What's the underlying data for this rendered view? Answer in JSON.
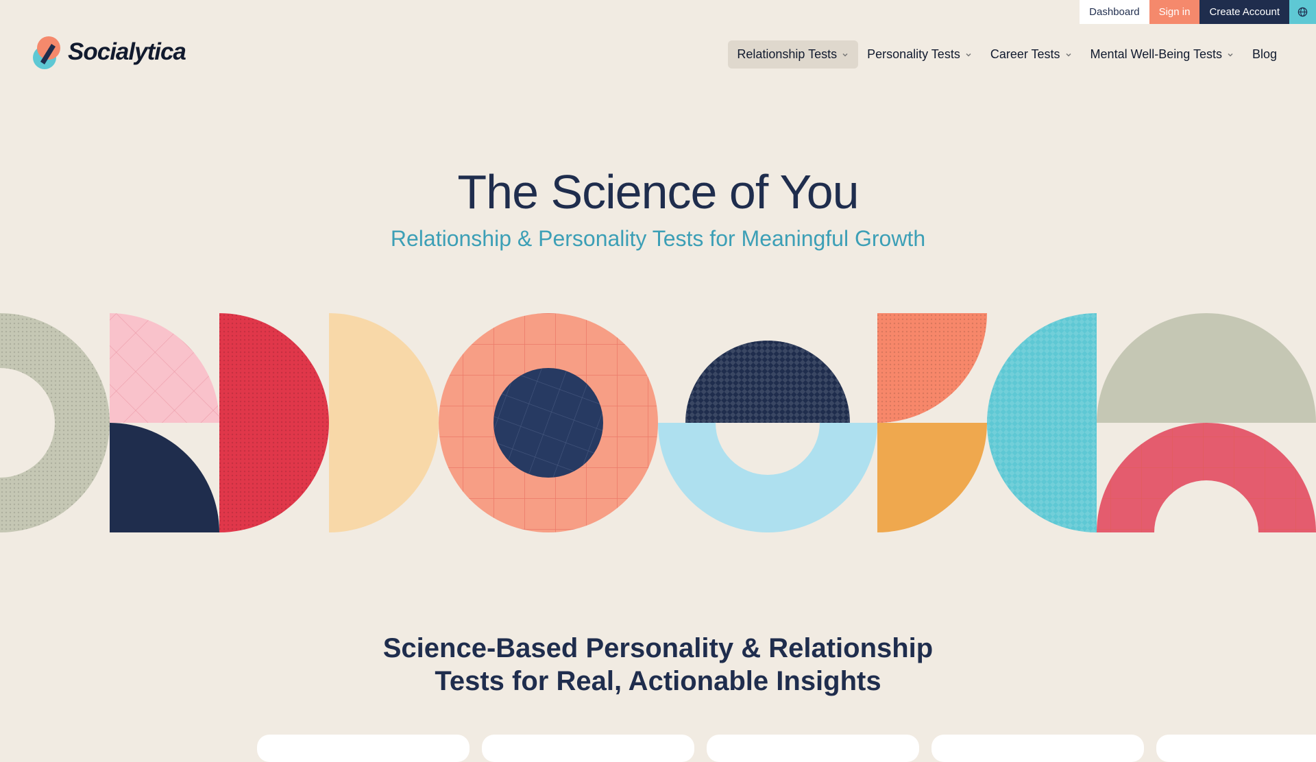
{
  "utility": {
    "dashboard": "Dashboard",
    "sign_in": "Sign in",
    "create_account": "Create Account",
    "globe_icon": "globe-icon"
  },
  "logo": {
    "text": "Socialytica"
  },
  "nav": {
    "items": [
      {
        "label": "Relationship Tests",
        "has_dropdown": true,
        "active": true
      },
      {
        "label": "Personality Tests",
        "has_dropdown": true,
        "active": false
      },
      {
        "label": "Career Tests",
        "has_dropdown": true,
        "active": false
      },
      {
        "label": "Mental Well-Being Tests",
        "has_dropdown": true,
        "active": false
      },
      {
        "label": "Blog",
        "has_dropdown": false,
        "active": false
      }
    ]
  },
  "hero": {
    "title": "The Science of You",
    "subtitle": "Relationship & Personality Tests for Meaningful Growth"
  },
  "section": {
    "title_line1": "Science-Based Personality & Relationship",
    "title_line2": "Tests for Real, Actionable Insights"
  },
  "colors": {
    "navy": "#1f2d4d",
    "coral": "#f5896c",
    "teal": "#5ec8d4",
    "sage": "#c5c7b4",
    "pink": "#f9c2cb",
    "red": "#e0374a",
    "cream": "#f8d8a8",
    "salmon": "#f79e85",
    "lightblue": "#aee0ef",
    "orange": "#efa84e",
    "rose": "#e45c6e",
    "background": "#f1ebe2"
  }
}
